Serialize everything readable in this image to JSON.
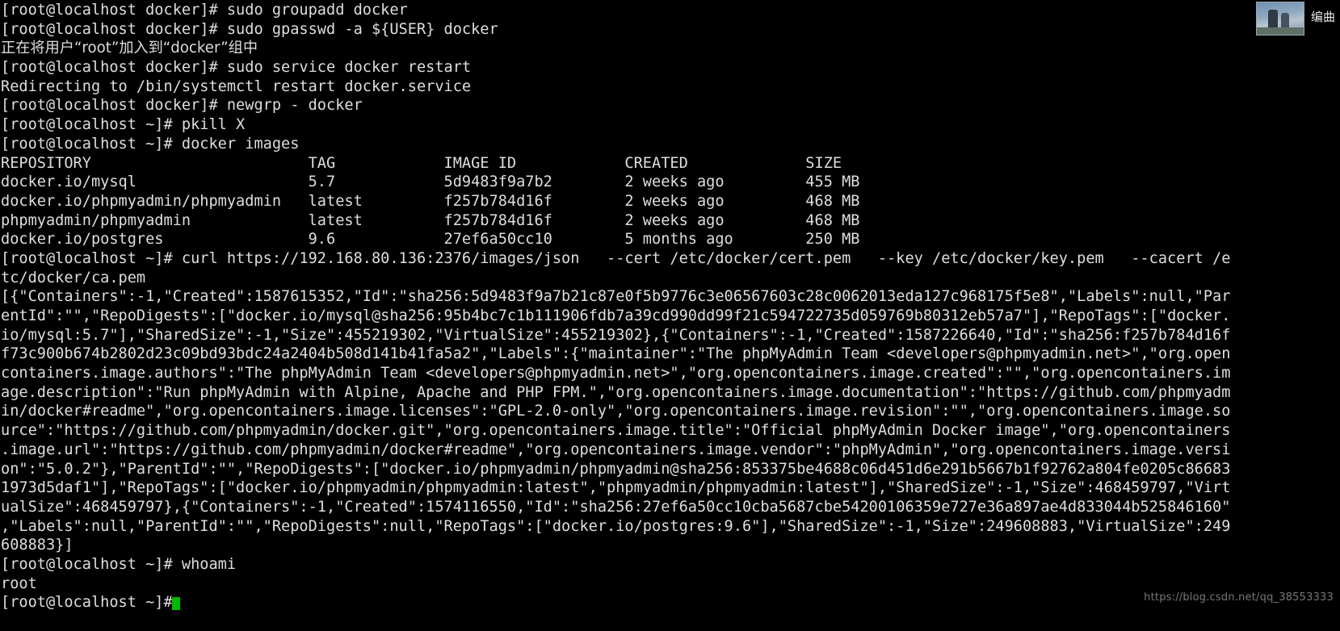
{
  "terminal": {
    "lines": [
      "[root@localhost docker]# sudo groupadd docker",
      "[root@localhost docker]# sudo gpasswd -a ${USER} docker",
      "正在将用户“root”加入到“docker”组中",
      "[root@localhost docker]# sudo service docker restart",
      "Redirecting to /bin/systemctl restart docker.service",
      "[root@localhost docker]# newgrp - docker",
      "[root@localhost ~]# pkill X",
      "[root@localhost ~]# docker images",
      "REPOSITORY                        TAG            IMAGE ID            CREATED             SIZE",
      "docker.io/mysql                   5.7            5d9483f9a7b2        2 weeks ago         455 MB",
      "docker.io/phpmyadmin/phpmyadmin   latest         f257b784d16f        2 weeks ago         468 MB",
      "phpmyadmin/phpmyadmin             latest         f257b784d16f        2 weeks ago         468 MB",
      "docker.io/postgres                9.6            27ef6a50cc10        5 months ago        250 MB",
      "[root@localhost ~]# curl https://192.168.80.136:2376/images/json   --cert /etc/docker/cert.pem   --key /etc/docker/key.pem   --cacert /e",
      "tc/docker/ca.pem",
      "[{\"Containers\":-1,\"Created\":1587615352,\"Id\":\"sha256:5d9483f9a7b21c87e0f5b9776c3e06567603c28c0062013eda127c968175f5e8\",\"Labels\":null,\"Par",
      "entId\":\"\",\"RepoDigests\":[\"docker.io/mysql@sha256:95b4bc7c1b111906fdb7a39cd990dd99f21c594722735d059769b80312eb57a7\"],\"RepoTags\":[\"docker.",
      "io/mysql:5.7\"],\"SharedSize\":-1,\"Size\":455219302,\"VirtualSize\":455219302},{\"Containers\":-1,\"Created\":1587226640,\"Id\":\"sha256:f257b784d16f",
      "f73c900b674b2802d23c09bd93bdc24a2404b508d141b41fa5a2\",\"Labels\":{\"maintainer\":\"The phpMyAdmin Team <developers@phpmyadmin.net>\",\"org.open",
      "containers.image.authors\":\"The phpMyAdmin Team <developers@phpmyadmin.net>\",\"org.opencontainers.image.created\":\"\",\"org.opencontainers.im",
      "age.description\":\"Run phpMyAdmin with Alpine, Apache and PHP FPM.\",\"org.opencontainers.image.documentation\":\"https://github.com/phpmyadm",
      "in/docker#readme\",\"org.opencontainers.image.licenses\":\"GPL-2.0-only\",\"org.opencontainers.image.revision\":\"\",\"org.opencontainers.image.so",
      "urce\":\"https://github.com/phpmyadmin/docker.git\",\"org.opencontainers.image.title\":\"Official phpMyAdmin Docker image\",\"org.opencontainers",
      ".image.url\":\"https://github.com/phpmyadmin/docker#readme\",\"org.opencontainers.image.vendor\":\"phpMyAdmin\",\"org.opencontainers.image.versi",
      "on\":\"5.0.2\"},\"ParentId\":\"\",\"RepoDigests\":[\"docker.io/phpmyadmin/phpmyadmin@sha256:853375be4688c06d451d6e291b5667b1f92762a804fe0205c86683",
      "1973d5daf1\"],\"RepoTags\":[\"docker.io/phpmyadmin/phpmyadmin:latest\",\"phpmyadmin/phpmyadmin:latest\"],\"SharedSize\":-1,\"Size\":468459797,\"Virt",
      "ualSize\":468459797},{\"Containers\":-1,\"Created\":1574116550,\"Id\":\"sha256:27ef6a50cc10cba5687cbe54200106359e727e36a897ae4d833044b525846160\"",
      ",\"Labels\":null,\"ParentId\":\"\",\"RepoDigests\":null,\"RepoTags\":[\"docker.io/postgres:9.6\"],\"SharedSize\":-1,\"Size\":249608883,\"VirtualSize\":249",
      "608883}]",
      "[root@localhost ~]# whoami",
      "root",
      "[root@localhost ~]#"
    ],
    "cjk_line_indices": [
      2
    ],
    "cursor": {
      "color": "#00b800",
      "line_index": 31
    },
    "colors": {
      "background": "#000000",
      "foreground": "#dedede"
    }
  },
  "watermark": {
    "text": "https://blog.csdn.net/qq_38553333",
    "color": "#8d8d8d"
  },
  "corner_widget": {
    "label": "编曲"
  }
}
